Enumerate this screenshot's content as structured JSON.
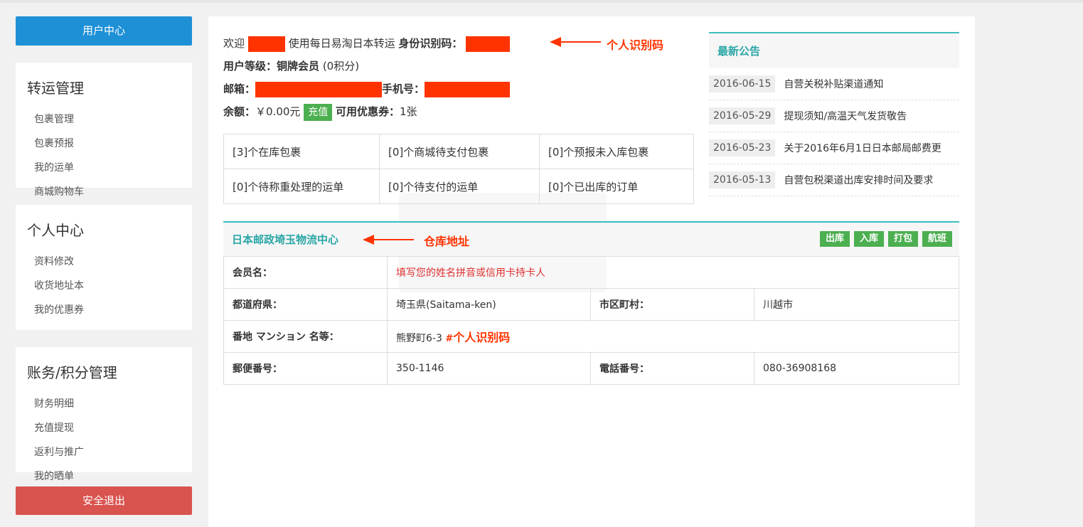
{
  "sidebar": {
    "user_center": "用户中心",
    "sections": [
      {
        "title": "转运管理",
        "links": [
          "包裹管理",
          "包裹预报",
          "我的运单",
          "商城购物车"
        ]
      },
      {
        "title": "个人中心",
        "links": [
          "资料修改",
          "收货地址本",
          "我的优惠券"
        ]
      },
      {
        "title": "账务/积分管理",
        "links": [
          "财务明细",
          "充值提现",
          "返利与推广",
          "我的晒单"
        ]
      }
    ],
    "logout": "安全退出"
  },
  "welcome": {
    "prefix": "欢迎",
    "middle": "使用每日易淘日本转运",
    "id_label": "身份识别码：",
    "level_label": "用户等级：",
    "level_value": "铜牌会员",
    "points": "(0积分)",
    "email_label": "邮箱：",
    "phone_label": "手机号：",
    "balance_label": "余额：",
    "balance_value": "￥0.00元",
    "recharge": "充值",
    "coupon_label": "可用优惠券：",
    "coupon_value": "1张"
  },
  "annotations": {
    "id_code": "个人识别码",
    "warehouse": "仓库地址",
    "inline_hash": "#",
    "inline_id": "个人识别码"
  },
  "stats": [
    [
      "[3]个在库包裹",
      "[0]个商城待支付包裹",
      "[0]个预报未入库包裹"
    ],
    [
      "[0]个待称重处理的运单",
      "[0]个待支付的运单",
      "[0]个已出库的订单"
    ]
  ],
  "notice": {
    "title": "最新公告",
    "items": [
      {
        "date": "2016-06-15",
        "title": "自营关税补贴渠道通知"
      },
      {
        "date": "2016-05-29",
        "title": "提现须知/高温天气发货敬告"
      },
      {
        "date": "2016-05-23",
        "title": "关于2016年6月1日日本邮局邮费更"
      },
      {
        "date": "2016-05-13",
        "title": "自营包税渠道出库安排时间及要求"
      }
    ]
  },
  "warehouse": {
    "title": "日本邮政埼玉物流中心",
    "buttons": [
      "出库",
      "入库",
      "打包",
      "航班"
    ],
    "member_label": "会员名：",
    "member_value": "填写您的姓名拼音或信用卡持卡人",
    "pref_label": "都道府県：",
    "pref_value": "埼玉県(Saitama-ken)",
    "city_label": "市区町村：",
    "city_value": "川越市",
    "addr_label": "番地 マンション 名等：",
    "addr_value": "熊野町6-3",
    "zip_label": "郵便番号：",
    "zip_value": "350-1146",
    "tel_label": "電話番号：",
    "tel_value": "080-36908168"
  },
  "colors": {
    "primary": "#1e90d6",
    "danger": "#d9534f",
    "success": "#4caf50",
    "teal": "#2aa6a6",
    "redact": "#ff3300"
  }
}
